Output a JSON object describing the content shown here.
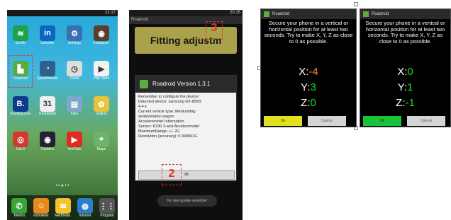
{
  "phone1": {
    "status_time": "21:17",
    "apps": [
      {
        "label": "Spotify",
        "icon": "spotify-icon",
        "bg": "#1aa34a",
        "glyph": "≋"
      },
      {
        "label": "LinkedIn",
        "icon": "linkedin-icon",
        "bg": "#0a66c2",
        "glyph": "in"
      },
      {
        "label": "Settings",
        "icon": "gear-icon",
        "bg": "#3a6fb0",
        "glyph": "⚙"
      },
      {
        "label": "Instagram",
        "icon": "camera-icon",
        "bg": "#5a3d2b",
        "glyph": "◉"
      },
      {
        "label": "Roadroid",
        "icon": "roadroid-icon",
        "bg": "#5bab3e",
        "glyph": "▙"
      },
      {
        "label": "Speedometer",
        "icon": "speedometer-icon",
        "bg": "#2f5f8e",
        "glyph": "◔"
      },
      {
        "label": "Clock",
        "icon": "clock-icon",
        "bg": "#dddddd",
        "glyph": "◷"
      },
      {
        "label": "Play Store",
        "icon": "play-store-icon",
        "bg": "#f2f2f2",
        "glyph": "▶"
      },
      {
        "label": "Booking.com",
        "icon": "booking-icon",
        "bg": "#0c3b8e",
        "glyph": "B."
      },
      {
        "label": "S Kalender",
        "icon": "calendar-icon",
        "bg": "#eeeeee",
        "glyph": "31"
      },
      {
        "label": "Files",
        "icon": "files-icon",
        "bg": "#7fa8c8",
        "glyph": "▤"
      },
      {
        "label": "Gallery",
        "icon": "gallery-icon",
        "bg": "#e8c33b",
        "glyph": "✿"
      },
      {
        "label": "Eat-it",
        "icon": "target-icon",
        "bg": "#d33a2e",
        "glyph": "◎"
      },
      {
        "label": "Kamera",
        "icon": "lens-icon",
        "bg": "#223",
        "glyph": "◉"
      },
      {
        "label": "YouTube",
        "icon": "youtube-icon",
        "bg": "#e02b20",
        "glyph": "▶"
      },
      {
        "label": "Maps",
        "icon": "maps-icon",
        "bg": "#6db36a",
        "glyph": "⌖"
      }
    ],
    "dock": [
      {
        "label": "Telefon",
        "icon": "phone-icon",
        "bg": "#3aa335",
        "glyph": "✆"
      },
      {
        "label": "Kontakter",
        "icon": "contacts-icon",
        "bg": "#e8891e",
        "glyph": "☺"
      },
      {
        "label": "Meddelan.",
        "icon": "messages-icon",
        "bg": "#f0c42a",
        "glyph": "✉"
      },
      {
        "label": "Internet",
        "icon": "internet-icon",
        "bg": "#2a7fc7",
        "glyph": "◍"
      },
      {
        "label": "Program",
        "icon": "apps-grid-icon",
        "bg": "#555555",
        "glyph": "⋮⋮"
      }
    ]
  },
  "phone2": {
    "status_time": "20:15",
    "app_title": "Roadroid",
    "fitting_label": "Fitting adjustm",
    "step3": "3",
    "step2": "2",
    "dialog_title": "Roadroid Version 1.3.1",
    "dialog_lines": [
      "Remember to configure the device!",
      "Detected device: samsung GT-I9505",
      "4.4.x",
      "Current vehicle type: Medium/big",
      "sedan/station wagon",
      "Accelerometer Information",
      "Sensor: K330 3-axis Accelerometer",
      "MaximumRange: +/- 2G",
      "Resolution (accuracy): 0.000061G"
    ],
    "ok_label": "ok",
    "toast": "No new update available!"
  },
  "calibration": [
    {
      "title": "Roadroid",
      "instruction": "Secure your phone in a vertical or horizontal position for at least two seconds. Try to make X, Y, Z as close to 0 as possible.",
      "x_label": "X:",
      "x_value": "-4",
      "y_label": "Y:",
      "y_value": "3",
      "z_label": "Z:",
      "z_value": "0",
      "ok_label": "Ok",
      "ok_color": "#e2e21a",
      "cancel_label": "Cancel"
    },
    {
      "title": "Roadroid",
      "instruction": "Secure your phone in a vertical or horizontal position for at least two seconds. Try to make X, Y, Z as close to 0 as possible.",
      "x_label": "X:",
      "x_value": "0",
      "y_label": "Y:",
      "y_value": "1",
      "z_label": "Z:",
      "z_value": "-1",
      "ok_label": "Ok",
      "ok_color": "#19c43a",
      "cancel_label": "Cancel"
    }
  ]
}
